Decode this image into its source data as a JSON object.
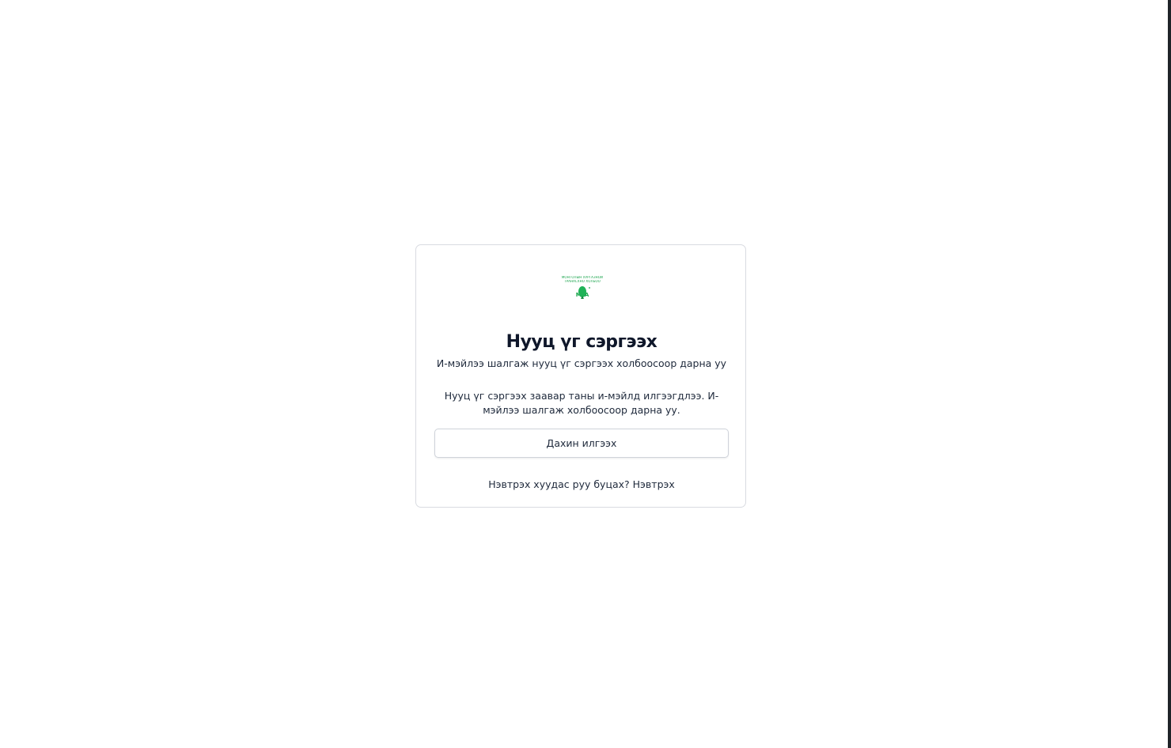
{
  "logo": {
    "line1": "МОНГОЛЫН ХУРГАЗНОЙ",
    "line2": "ТРАНАСХНО ХОЛБОО",
    "mark_text": "MTA",
    "color": "#17a34a",
    "icon": "logo-mark"
  },
  "title": "Нууц үг сэргээх",
  "subtitle": "И-мэйлээ шалгаж нууц үг сэргээх холбоосоор дарна уу",
  "message": "Нууц үг сэргээх заавар таны и-мэйлд илгээгдлээ. И-мэйлээ шалгаж холбоосоор дарна уу.",
  "resend_button": "Дахин илгээх",
  "footer": {
    "prompt": "Нэвтрэх хуудас руу буцах?",
    "link": "Нэвтрэх"
  }
}
